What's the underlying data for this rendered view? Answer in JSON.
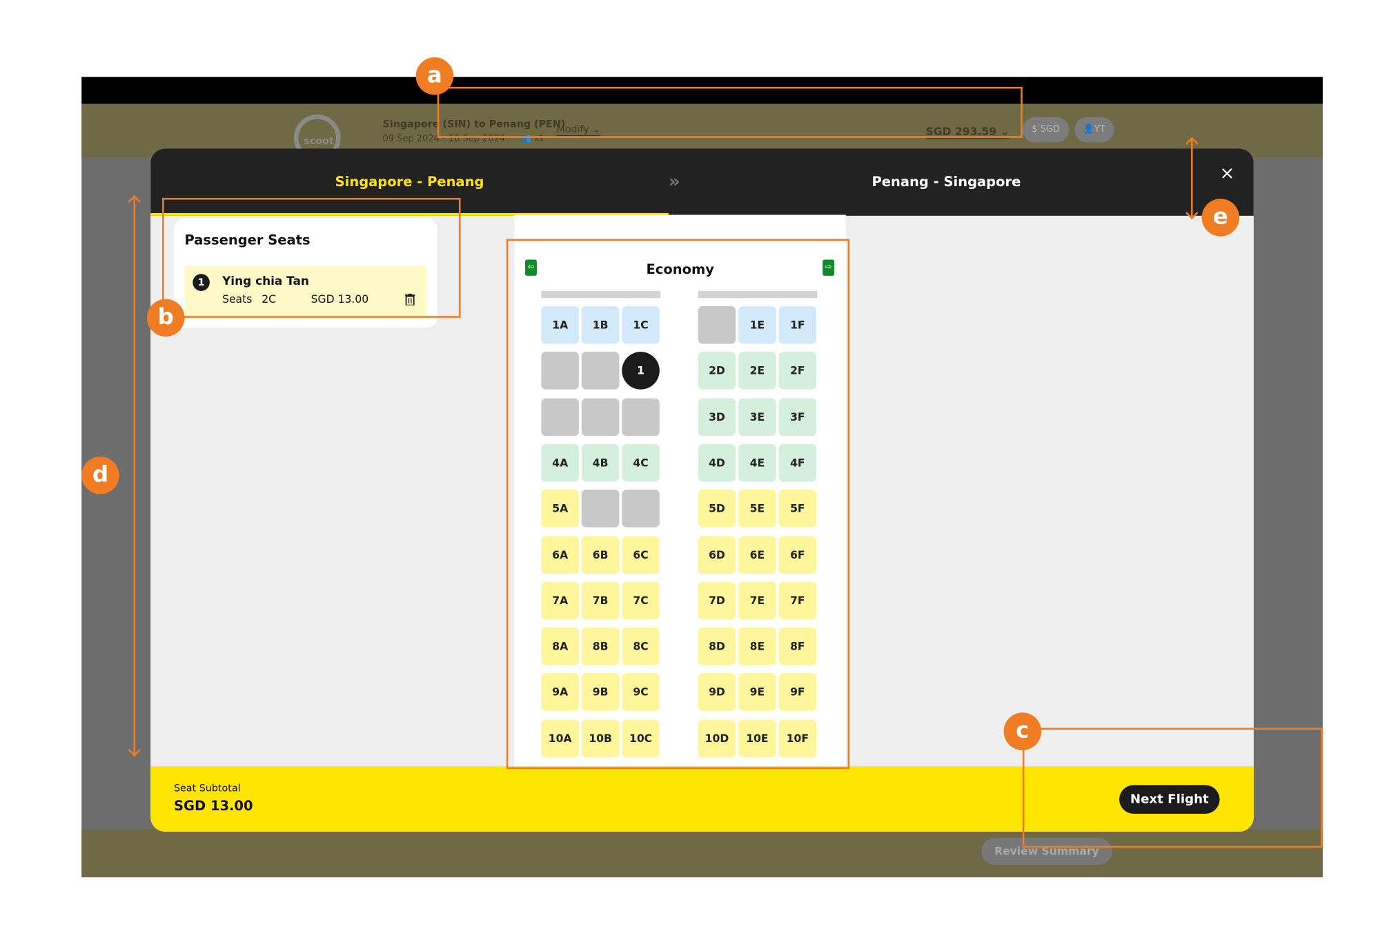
{
  "header": {
    "logo_text": "scoot",
    "route": "Singapore (SIN) to Penang (PEN)",
    "dates": "09 Sep 2024 - 16 Sep 2024",
    "passenger_count": "x1",
    "modify_label": "Modify",
    "total_price": "SGD 293.59",
    "currency_label": "SGD",
    "user_initials": "YT"
  },
  "modal": {
    "tab_outbound": "Singapore - Penang",
    "tab_separator": "»",
    "tab_return": "Penang - Singapore",
    "close_label": "×"
  },
  "passenger_card": {
    "title": "Passenger Seats",
    "passenger_number": "1",
    "passenger_name": "Ying chia Tan",
    "seats_label": "Seats",
    "seat_number": "2C",
    "price": "SGD 13.00"
  },
  "cabin": {
    "title": "Economy",
    "rows": [
      {
        "left": [
          {
            "label": "1A",
            "status": "blue"
          },
          {
            "label": "1B",
            "status": "blue"
          },
          {
            "label": "1C",
            "status": "blue"
          }
        ],
        "right": [
          {
            "label": "",
            "status": "grey"
          },
          {
            "label": "1E",
            "status": "blue"
          },
          {
            "label": "1F",
            "status": "blue"
          }
        ]
      },
      {
        "left": [
          {
            "label": "",
            "status": "grey"
          },
          {
            "label": "",
            "status": "grey"
          },
          {
            "label": "1",
            "status": "selected"
          }
        ],
        "right": [
          {
            "label": "2D",
            "status": "green"
          },
          {
            "label": "2E",
            "status": "green"
          },
          {
            "label": "2F",
            "status": "green"
          }
        ]
      },
      {
        "left": [
          {
            "label": "",
            "status": "grey"
          },
          {
            "label": "",
            "status": "grey"
          },
          {
            "label": "",
            "status": "grey"
          }
        ],
        "right": [
          {
            "label": "3D",
            "status": "green"
          },
          {
            "label": "3E",
            "status": "green"
          },
          {
            "label": "3F",
            "status": "green"
          }
        ]
      },
      {
        "left": [
          {
            "label": "4A",
            "status": "green"
          },
          {
            "label": "4B",
            "status": "green"
          },
          {
            "label": "4C",
            "status": "green"
          }
        ],
        "right": [
          {
            "label": "4D",
            "status": "green"
          },
          {
            "label": "4E",
            "status": "green"
          },
          {
            "label": "4F",
            "status": "green"
          }
        ]
      },
      {
        "left": [
          {
            "label": "5A",
            "status": "yellow"
          },
          {
            "label": "",
            "status": "grey"
          },
          {
            "label": "",
            "status": "grey"
          }
        ],
        "right": [
          {
            "label": "5D",
            "status": "yellow"
          },
          {
            "label": "5E",
            "status": "yellow"
          },
          {
            "label": "5F",
            "status": "yellow"
          }
        ]
      },
      {
        "left": [
          {
            "label": "6A",
            "status": "yellow"
          },
          {
            "label": "6B",
            "status": "yellow"
          },
          {
            "label": "6C",
            "status": "yellow"
          }
        ],
        "right": [
          {
            "label": "6D",
            "status": "yellow"
          },
          {
            "label": "6E",
            "status": "yellow"
          },
          {
            "label": "6F",
            "status": "yellow"
          }
        ]
      },
      {
        "left": [
          {
            "label": "7A",
            "status": "yellow"
          },
          {
            "label": "7B",
            "status": "yellow"
          },
          {
            "label": "7C",
            "status": "yellow"
          }
        ],
        "right": [
          {
            "label": "7D",
            "status": "yellow"
          },
          {
            "label": "7E",
            "status": "yellow"
          },
          {
            "label": "7F",
            "status": "yellow"
          }
        ]
      },
      {
        "left": [
          {
            "label": "8A",
            "status": "yellow"
          },
          {
            "label": "8B",
            "status": "yellow"
          },
          {
            "label": "8C",
            "status": "yellow"
          }
        ],
        "right": [
          {
            "label": "8D",
            "status": "yellow"
          },
          {
            "label": "8E",
            "status": "yellow"
          },
          {
            "label": "8F",
            "status": "yellow"
          }
        ]
      },
      {
        "left": [
          {
            "label": "9A",
            "status": "yellow"
          },
          {
            "label": "9B",
            "status": "yellow"
          },
          {
            "label": "9C",
            "status": "yellow"
          }
        ],
        "right": [
          {
            "label": "9D",
            "status": "yellow"
          },
          {
            "label": "9E",
            "status": "yellow"
          },
          {
            "label": "9F",
            "status": "yellow"
          }
        ]
      },
      {
        "left": [
          {
            "label": "10A",
            "status": "yellow"
          },
          {
            "label": "10B",
            "status": "yellow"
          },
          {
            "label": "10C",
            "status": "yellow"
          }
        ],
        "right": [
          {
            "label": "10D",
            "status": "yellow"
          },
          {
            "label": "10E",
            "status": "yellow"
          },
          {
            "label": "10F",
            "status": "yellow"
          }
        ]
      }
    ]
  },
  "footer": {
    "subtotal_label": "Seat Subtotal",
    "subtotal_value": "SGD 13.00",
    "next_button": "Next Flight",
    "review_button": "Review Summary"
  },
  "annotations": {
    "a": "a",
    "b": "b",
    "c": "c",
    "d": "d",
    "e": "e"
  },
  "colors": {
    "accent_yellow": "#ffe500",
    "annotation_orange": "#f07d24",
    "seat_blue": "#d2e9fa",
    "seat_green": "#d4f0dc",
    "seat_yellow": "#fff59b",
    "seat_unavailable": "#c8c8c8"
  }
}
